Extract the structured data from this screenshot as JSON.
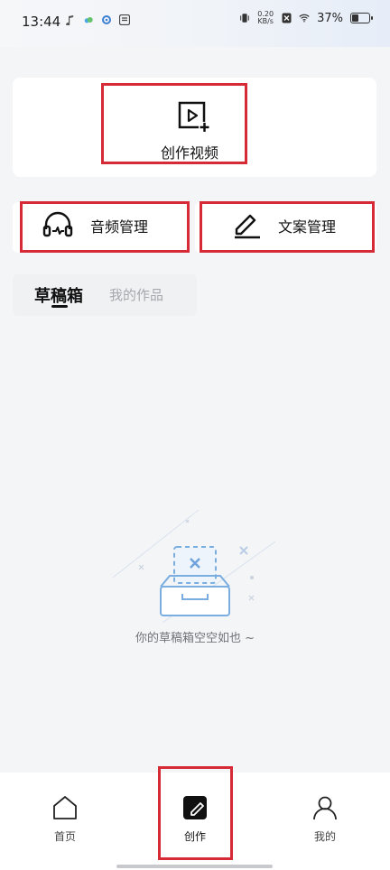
{
  "status_bar": {
    "time": "13:44",
    "speed_value": "0.20",
    "speed_unit": "KB/s",
    "battery_percent": "37%",
    "battery_level": 0.37,
    "icons": [
      "music-note-icon",
      "cloud-icon",
      "gear-icon",
      "app-badge-icon",
      "vibrate-icon",
      "sim-x-icon",
      "wifi-icon",
      "battery-icon"
    ]
  },
  "create_card": {
    "label": "创作视频",
    "icon": "video-plus-icon"
  },
  "tiles": {
    "audio": {
      "label": "音频管理",
      "icon": "headphones-icon"
    },
    "copy": {
      "label": "文案管理",
      "icon": "edit-icon"
    }
  },
  "tabs": {
    "active": "草稿箱",
    "inactive": "我的作品"
  },
  "empty_state": {
    "text": "你的草稿箱空空如也 ~",
    "icon": "empty-box-icon"
  },
  "bottom_nav": {
    "home": {
      "label": "首页",
      "icon": "home-icon"
    },
    "create": {
      "label": "创作",
      "icon": "create-icon"
    },
    "mine": {
      "label": "我的",
      "icon": "user-icon"
    }
  },
  "colors": {
    "highlight": "#d62b36",
    "background": "#f4f5f7",
    "card": "#ffffff"
  }
}
